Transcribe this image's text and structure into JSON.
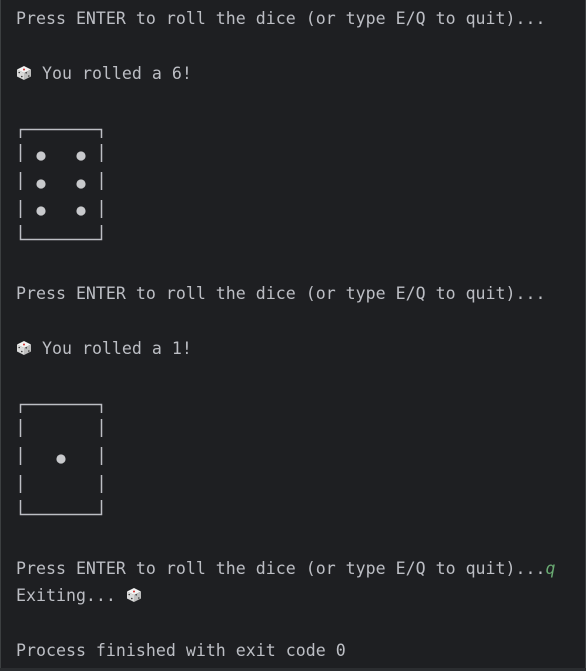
{
  "console": {
    "prompt1": "Press ENTER to roll the dice (or type E/Q to quit)...",
    "result1": " You rolled a 6!",
    "prompt2": "Press ENTER to roll the dice (or type E/Q to quit)...",
    "result2": " You rolled a 1!",
    "prompt3": "Press ENTER to roll the dice (or type E/Q to quit)...",
    "user_input": "q",
    "exiting": "Exiting... ",
    "process_end": "Process finished with exit code 0"
  },
  "dice": [
    {
      "face": 6
    },
    {
      "face": 1
    }
  ],
  "colors": {
    "background": "#1e1f22",
    "text": "#bcbec4",
    "input": "#6aab73",
    "pip": "#c8c9cc",
    "frame": "#bcbec4"
  },
  "icons": [
    "dice-emoji-icon"
  ]
}
